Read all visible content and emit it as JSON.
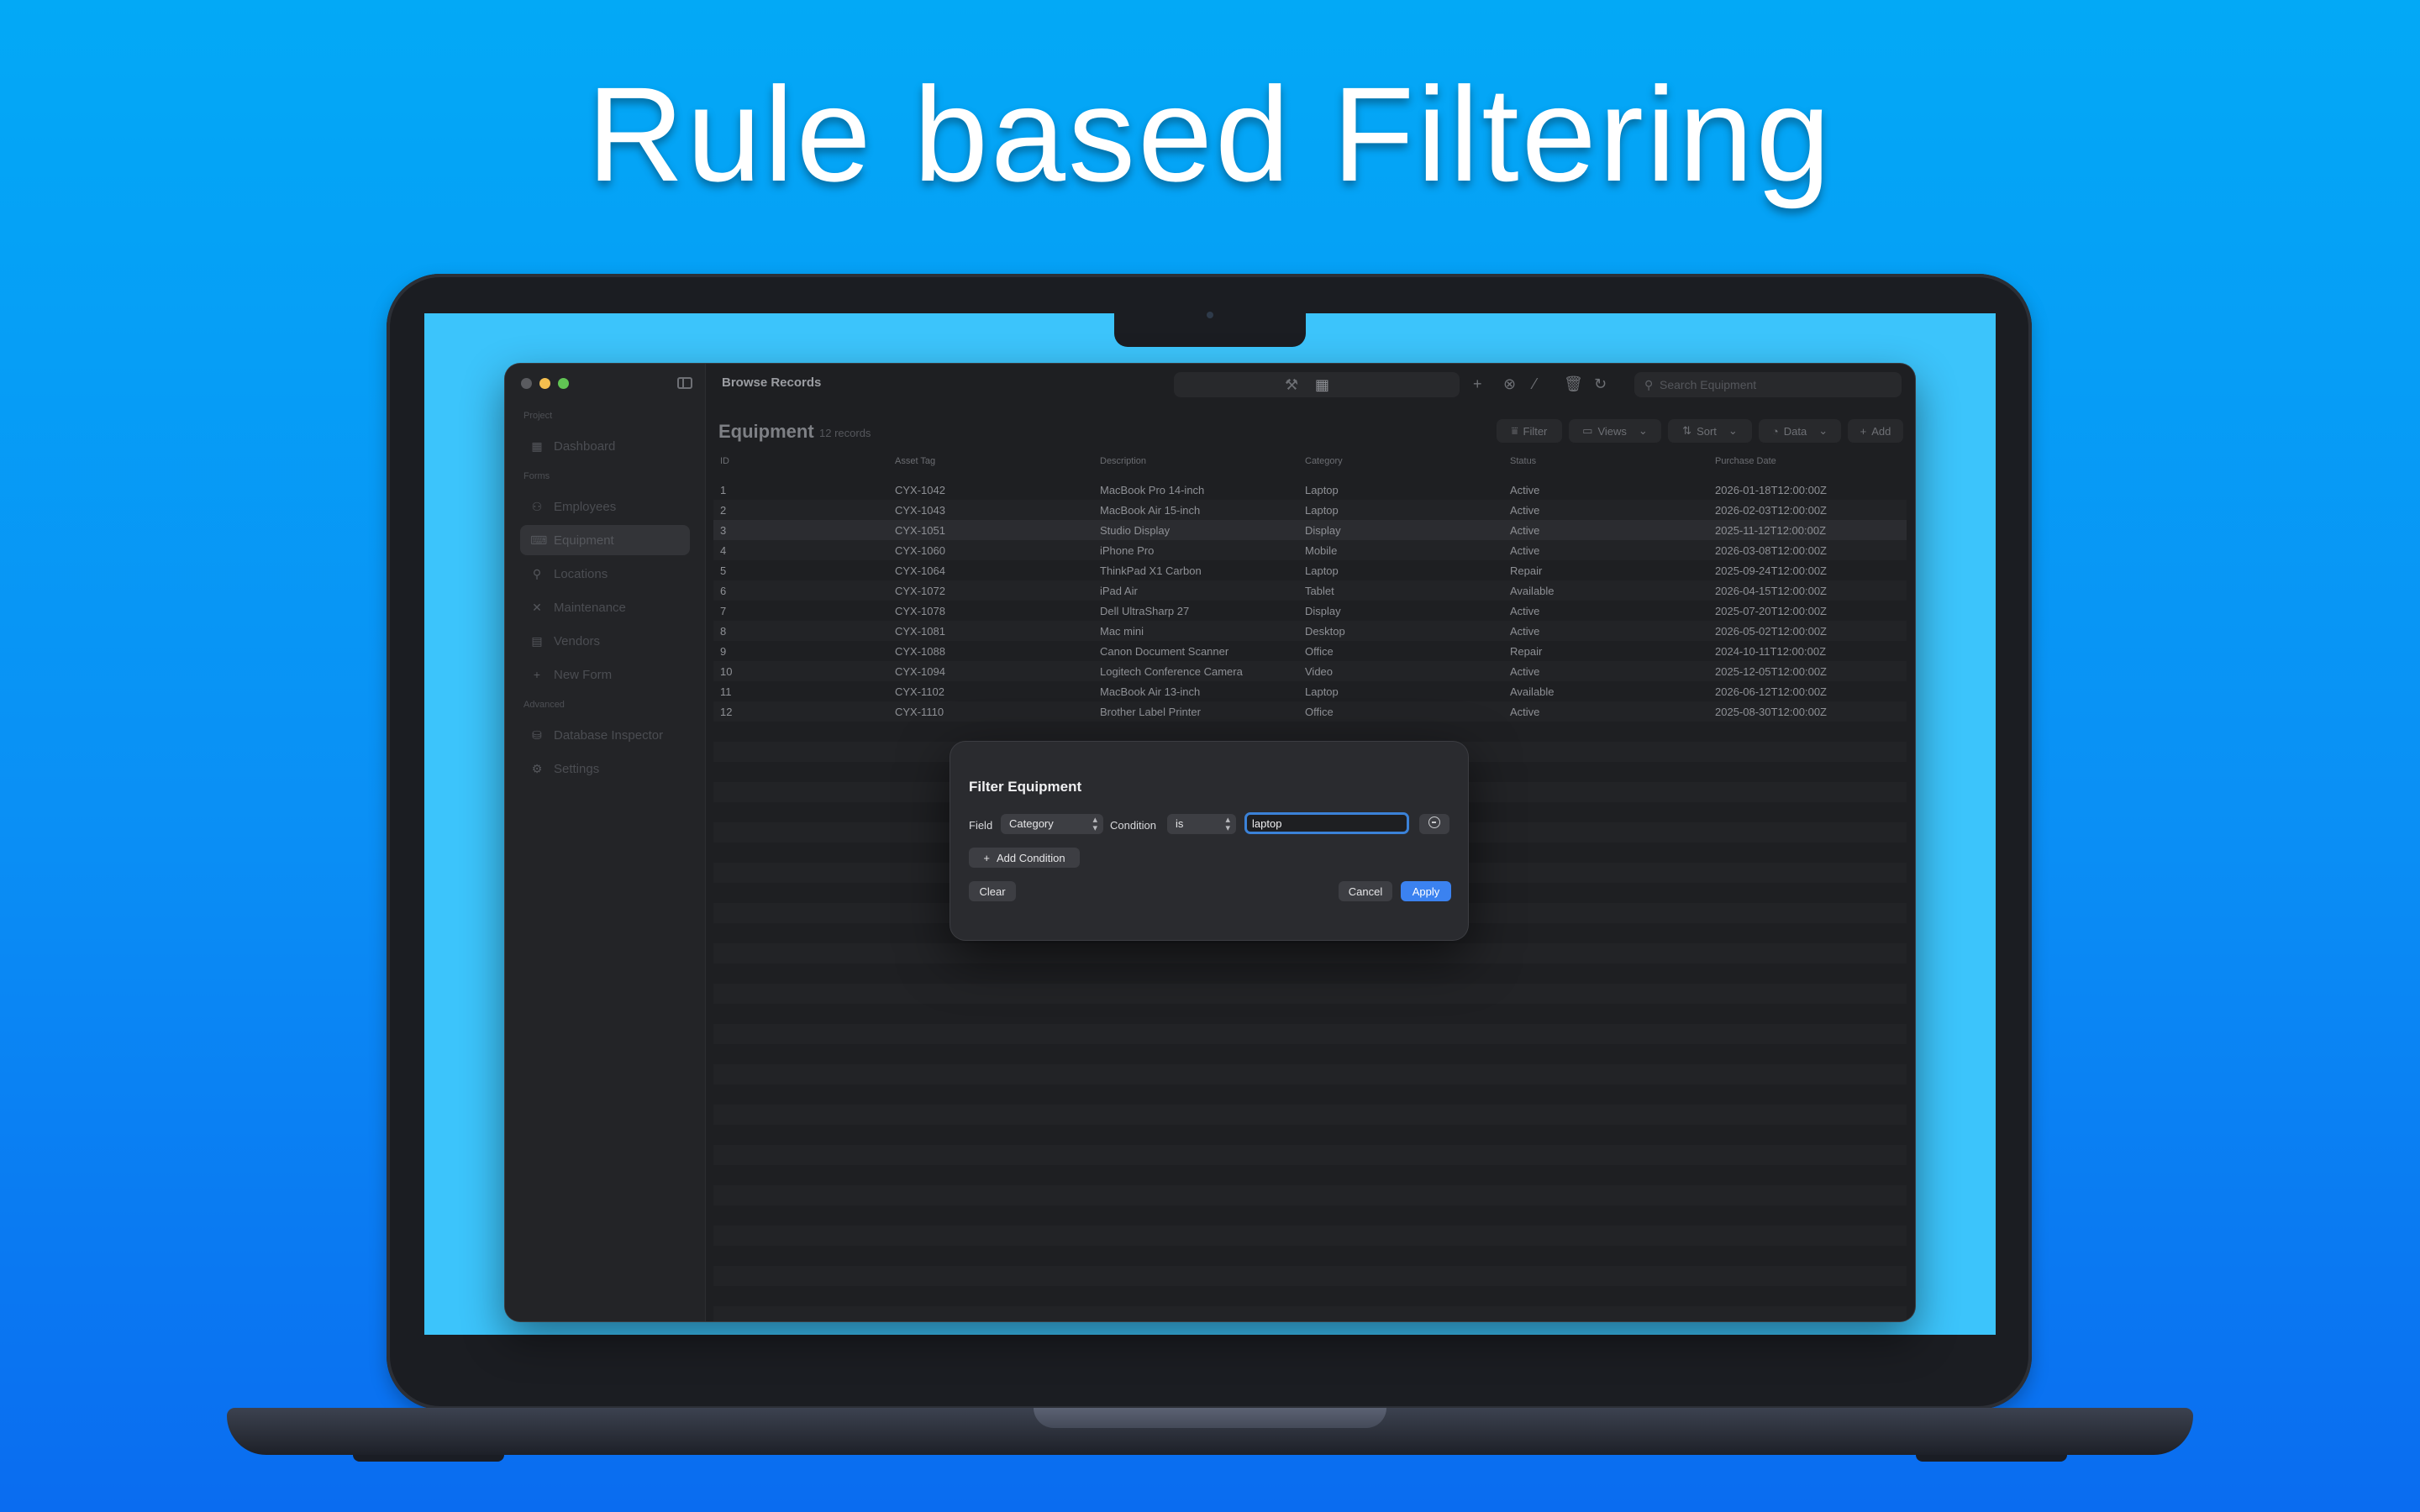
{
  "headline": "Rule based Filtering",
  "window": {
    "title": "Browse Records",
    "search_placeholder": "Search Equipment"
  },
  "sidebar": {
    "sections": {
      "project": "Project",
      "forms": "Forms",
      "advanced": "Advanced"
    },
    "items": [
      {
        "label": "Dashboard",
        "icon": "grid-icon"
      },
      {
        "label": "Employees",
        "icon": "people-icon"
      },
      {
        "label": "Equipment",
        "icon": "keyboard-icon"
      },
      {
        "label": "Locations",
        "icon": "pin-icon"
      },
      {
        "label": "Maintenance",
        "icon": "tools-icon"
      },
      {
        "label": "Vendors",
        "icon": "building-icon"
      },
      {
        "label": "New Form",
        "icon": "plus-icon"
      },
      {
        "label": "Database Inspector",
        "icon": "database-icon"
      },
      {
        "label": "Settings",
        "icon": "gear-icon"
      }
    ]
  },
  "content": {
    "title": "Equipment",
    "count": "12 records",
    "buttons": {
      "filter": "Filter",
      "views": "Views",
      "sort": "Sort",
      "data": "Data",
      "add": "Add"
    }
  },
  "table": {
    "columns": [
      "ID",
      "Asset Tag",
      "Description",
      "Category",
      "Status",
      "Purchase Date"
    ],
    "rows": [
      [
        "1",
        "CYX-1042",
        "MacBook Pro 14-inch",
        "Laptop",
        "Active",
        "2026-01-18T12:00:00Z"
      ],
      [
        "2",
        "CYX-1043",
        "MacBook Air 15-inch",
        "Laptop",
        "Active",
        "2026-02-03T12:00:00Z"
      ],
      [
        "3",
        "CYX-1051",
        "Studio Display",
        "Display",
        "Active",
        "2025-11-12T12:00:00Z"
      ],
      [
        "4",
        "CYX-1060",
        "iPhone Pro",
        "Mobile",
        "Active",
        "2026-03-08T12:00:00Z"
      ],
      [
        "5",
        "CYX-1064",
        "ThinkPad X1 Carbon",
        "Laptop",
        "Repair",
        "2025-09-24T12:00:00Z"
      ],
      [
        "6",
        "CYX-1072",
        "iPad Air",
        "Tablet",
        "Available",
        "2026-04-15T12:00:00Z"
      ],
      [
        "7",
        "CYX-1078",
        "Dell UltraSharp 27",
        "Display",
        "Active",
        "2025-07-20T12:00:00Z"
      ],
      [
        "8",
        "CYX-1081",
        "Mac mini",
        "Desktop",
        "Active",
        "2026-05-02T12:00:00Z"
      ],
      [
        "9",
        "CYX-1088",
        "Canon Document Scanner",
        "Office",
        "Repair",
        "2024-10-11T12:00:00Z"
      ],
      [
        "10",
        "CYX-1094",
        "Logitech Conference Camera",
        "Video",
        "Active",
        "2025-12-05T12:00:00Z"
      ],
      [
        "11",
        "CYX-1102",
        "MacBook Air 13-inch",
        "Laptop",
        "Available",
        "2026-06-12T12:00:00Z"
      ],
      [
        "12",
        "CYX-1110",
        "Brother Label Printer",
        "Office",
        "Active",
        "2025-08-30T12:00:00Z"
      ]
    ]
  },
  "modal": {
    "title": "Filter Equipment",
    "field_label": "Field",
    "field_value": "Category",
    "condition_label": "Condition",
    "condition_value": "is",
    "text_value": "laptop",
    "add_condition": "Add Condition",
    "clear": "Clear",
    "cancel": "Cancel",
    "apply": "Apply"
  },
  "colors": {
    "background_top": "#03a9f6",
    "background_bottom": "#0a6cf0",
    "screen": "#3cc4fb",
    "accent": "#3b82f0"
  }
}
